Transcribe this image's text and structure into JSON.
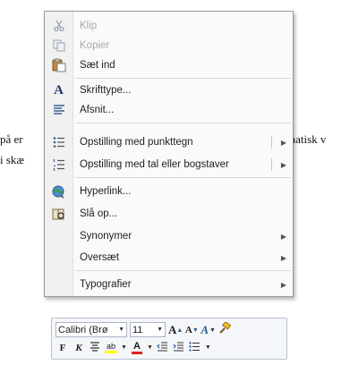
{
  "document": {
    "left_line1": "på er",
    "left_line2": "i skæ",
    "right_line1": "matisk v"
  },
  "context_menu": {
    "items": [
      {
        "label": "Klip",
        "icon": "scissors-icon",
        "disabled": true
      },
      {
        "label": "Kopier",
        "icon": "copy-icon",
        "disabled": true
      },
      {
        "label": "Sæt ind",
        "icon": "paste-icon"
      },
      {
        "label": "Skrifttype...",
        "icon": "font-icon"
      },
      {
        "label": "Afsnit...",
        "icon": "paragraph-icon"
      },
      {
        "label": "Opstilling med punkttegn",
        "icon": "bullets-icon",
        "submenu": true,
        "split": true
      },
      {
        "label": "Opstilling med tal eller bogstaver",
        "icon": "numbering-icon",
        "submenu": true,
        "split": true
      },
      {
        "label": "Hyperlink...",
        "icon": "hyperlink-icon"
      },
      {
        "label": "Slå op...",
        "icon": "lookup-icon"
      },
      {
        "label": "Synonymer",
        "submenu": true
      },
      {
        "label": "Oversæt",
        "submenu": true
      },
      {
        "label": "Typografier",
        "submenu": true
      }
    ]
  },
  "mini_toolbar": {
    "font_name": "Calibri (Brø",
    "font_size": "11",
    "bold": "F",
    "italic": "K",
    "grow_font": "A",
    "shrink_font": "A",
    "styles": "A",
    "font_color": "A",
    "highlight": "ab"
  },
  "colors": {
    "font_color_bar": "#e02020",
    "highlight_bar": "#ffff00",
    "menu_bg": "#fafafa"
  }
}
